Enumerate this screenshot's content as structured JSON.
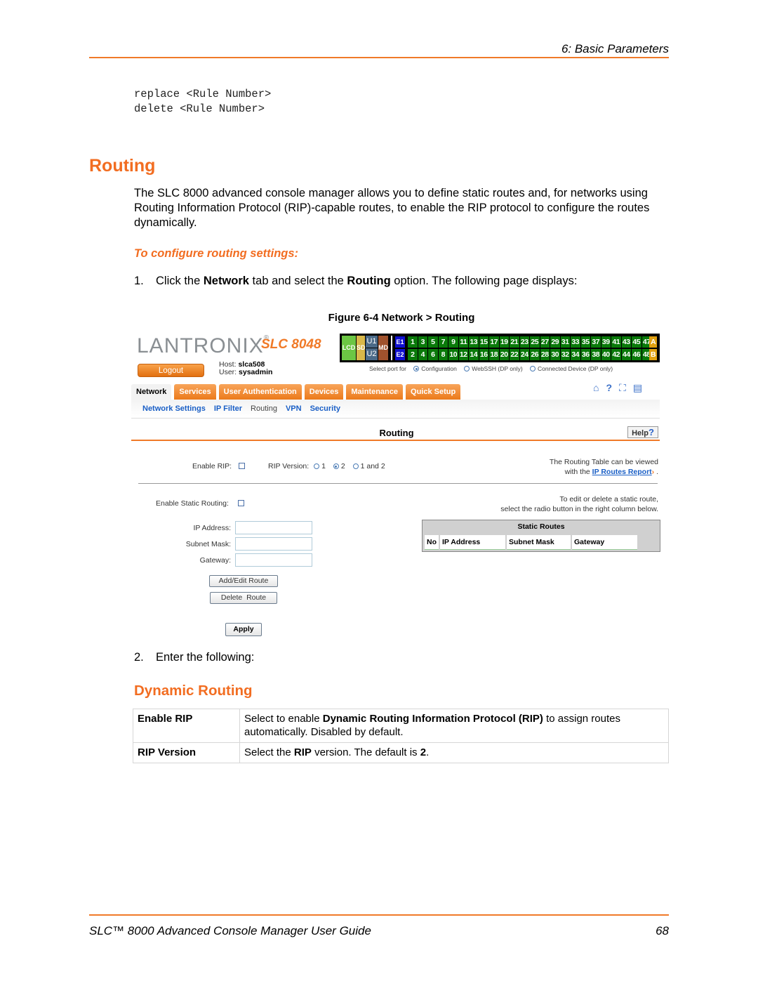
{
  "header": {
    "section": "6: Basic Parameters"
  },
  "code_lines": [
    "replace <Rule Number>",
    "delete <Rule Number>"
  ],
  "heading": "Routing",
  "intro": "The SLC 8000 advanced console manager allows you to define static routes and, for networks using Routing Information Protocol (RIP)-capable routes, to enable the RIP protocol to configure the routes dynamically.",
  "procedure_title": "To configure routing settings:",
  "step1": {
    "num": "1.",
    "pre": "Click the ",
    "b1": "Network",
    "mid": " tab and select the ",
    "b2": "Routing",
    "post": " option. The following page displays:"
  },
  "figure_caption": "Figure 6-4  Network > Routing",
  "screenshot": {
    "logo": "LANTRONIX",
    "logo_mark": "®",
    "model": "SLC 8048",
    "logout_label": "Logout",
    "host_label": "Host:",
    "host_value": "slca508",
    "user_label": "User:",
    "user_value": "sysadmin",
    "port_panel": {
      "lcd": "LCD",
      "sd": "SD",
      "u1": "U1",
      "u2": "U2",
      "md": "MD",
      "e1": "E1",
      "e2": "E2",
      "odd_ports": [
        "1",
        "3",
        "5",
        "7",
        "9",
        "11",
        "13",
        "15",
        "17",
        "19",
        "21",
        "23",
        "25",
        "27",
        "29",
        "31",
        "33",
        "35",
        "37",
        "39",
        "41",
        "43",
        "45",
        "47"
      ],
      "even_ports": [
        "2",
        "4",
        "6",
        "8",
        "10",
        "12",
        "14",
        "16",
        "18",
        "20",
        "22",
        "24",
        "26",
        "28",
        "30",
        "32",
        "34",
        "36",
        "38",
        "40",
        "42",
        "44",
        "46",
        "48"
      ],
      "a": "A",
      "b": "B",
      "colors": {
        "lcd": "#6cc644",
        "sd": "#d9b84a",
        "u": "#4b6a88",
        "md": "#a0522d",
        "e": "#1010d0",
        "port": "#0a7a0a",
        "ab": "#e0a010"
      }
    },
    "select_port": {
      "label": "Select port for",
      "options": [
        "Configuration",
        "WebSSH (DP only)",
        "Connected Device (DP only)"
      ],
      "selected": "Configuration"
    },
    "tabs": [
      "Network",
      "Services",
      "User Authentication",
      "Devices",
      "Maintenance",
      "Quick Setup"
    ],
    "active_tab": "Network",
    "tool_icons": [
      "home-icon",
      "help-icon",
      "fullscreen-icon",
      "log-icon"
    ],
    "subnav": [
      "Network Settings",
      "IP Filter",
      "Routing",
      "VPN",
      "Security"
    ],
    "current_subnav": "Routing",
    "section_title": "Routing",
    "help_label": "Help",
    "enable_rip_label": "Enable RIP:",
    "enable_rip_checked": false,
    "rip_version_label": "RIP Version:",
    "rip_options": [
      "1",
      "2",
      "1 and 2"
    ],
    "rip_selected": "2",
    "routing_table_note_1": "The Routing Table can be viewed",
    "routing_table_note_2": "with the",
    "ip_routes_link": "IP Routes Report",
    "enable_static_label": "Enable Static Routing:",
    "enable_static_checked": false,
    "edit_note_1": "To edit or delete a static route,",
    "edit_note_2": "select the radio button in the right column below.",
    "fields": [
      {
        "label": "IP Address:",
        "value": ""
      },
      {
        "label": "Subnet Mask:",
        "value": ""
      },
      {
        "label": "Gateway:",
        "value": ""
      }
    ],
    "add_edit_label": "Add/Edit Route",
    "delete_label": "Delete  Route",
    "apply_label": "Apply",
    "static_routes": {
      "title": "Static Routes",
      "columns": [
        "No",
        "IP Address",
        "Subnet Mask",
        "Gateway"
      ],
      "rows": []
    }
  },
  "step2": {
    "num": "2.",
    "text": "Enter the following:"
  },
  "subheading": "Dynamic Routing",
  "table": [
    {
      "key": "Enable RIP",
      "pre": "Select to enable ",
      "bold": "Dynamic Routing Information Protocol (RIP)",
      "post": " to assign routes automatically. Disabled by default."
    },
    {
      "key": "RIP Version",
      "pre": "Select the ",
      "bold": "RIP",
      "mid": " version. The default is ",
      "bold2": "2",
      "post": "."
    }
  ],
  "footer": {
    "title": "SLC™ 8000 Advanced Console Manager User Guide",
    "page": "68"
  },
  "accent_color": "#f26d21"
}
